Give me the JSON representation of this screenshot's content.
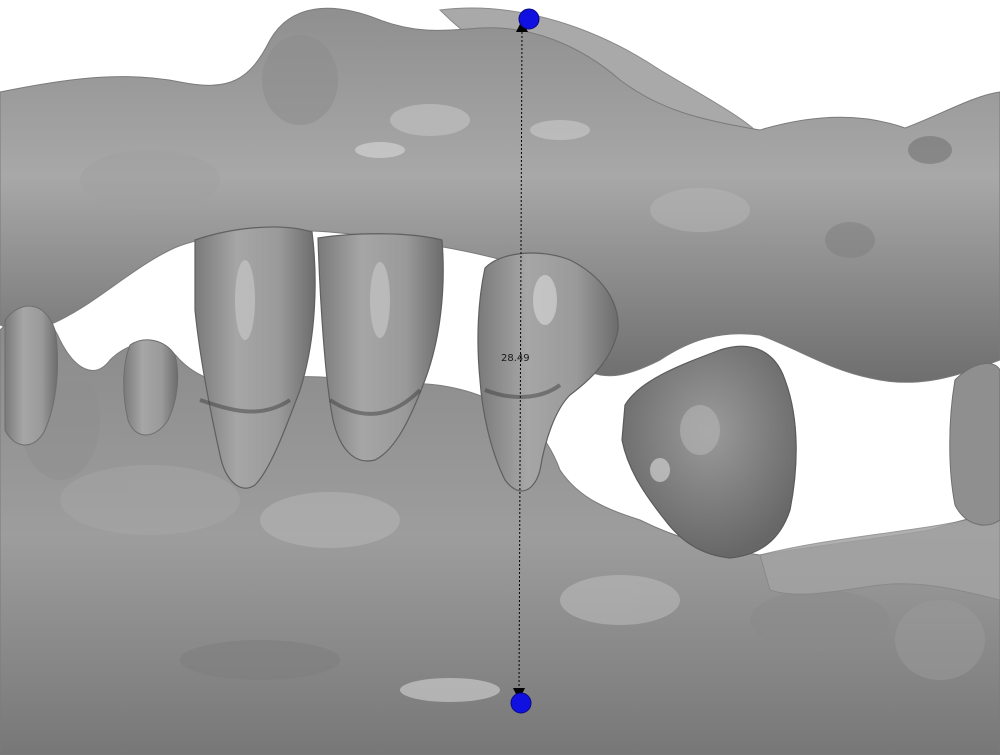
{
  "viewer": {
    "measurement": {
      "label": "28.49",
      "start_point_color": "#1010e0",
      "end_point_color": "#1010e0",
      "line_color": "#000000"
    },
    "model": {
      "surface_color": "#9a9a9a",
      "highlight_color": "#d8d8d8",
      "shadow_color": "#5a5a5a"
    },
    "background_color": "#ffffff"
  }
}
